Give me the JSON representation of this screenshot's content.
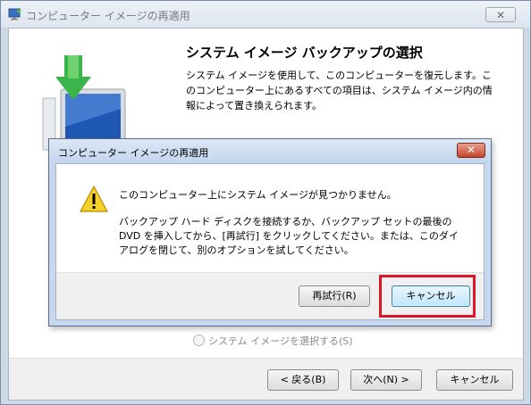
{
  "outer_window": {
    "title": "コンピューター イメージの再適用",
    "close_glyph": "✕"
  },
  "wizard": {
    "heading": "システム イメージ バックアップの選択",
    "description": "システム イメージを使用して、このコンピューターを復元します。このコンピューター上にあるすべての項目は、システム イメージ内の情報によって置き換えられます。",
    "radio_select_image": "システム イメージを選択する(S)",
    "buttons": {
      "back": "< 戻る(B)",
      "next": "次へ(N) >",
      "cancel": "キャンセル"
    }
  },
  "dialog": {
    "title": "コンピューター イメージの再適用",
    "close_glyph": "✕",
    "main_message": "このコンピューター上にシステム イメージが見つかりません。",
    "detail": "バックアップ ハード ディスクを接続するか、バックアップ セットの最後の DVD を挿入してから、[再試行] をクリックしてください。または、このダイアログを閉じて、別のオプションを試してください。",
    "buttons": {
      "retry": "再試行(R)",
      "cancel": "キャンセル"
    }
  },
  "icons": {
    "warning": "warning-icon",
    "app": "system-restore-icon",
    "illustration": "computer-restore-icon"
  },
  "colors": {
    "highlight": "#d9182a",
    "dialog_close": "#c5442c"
  }
}
